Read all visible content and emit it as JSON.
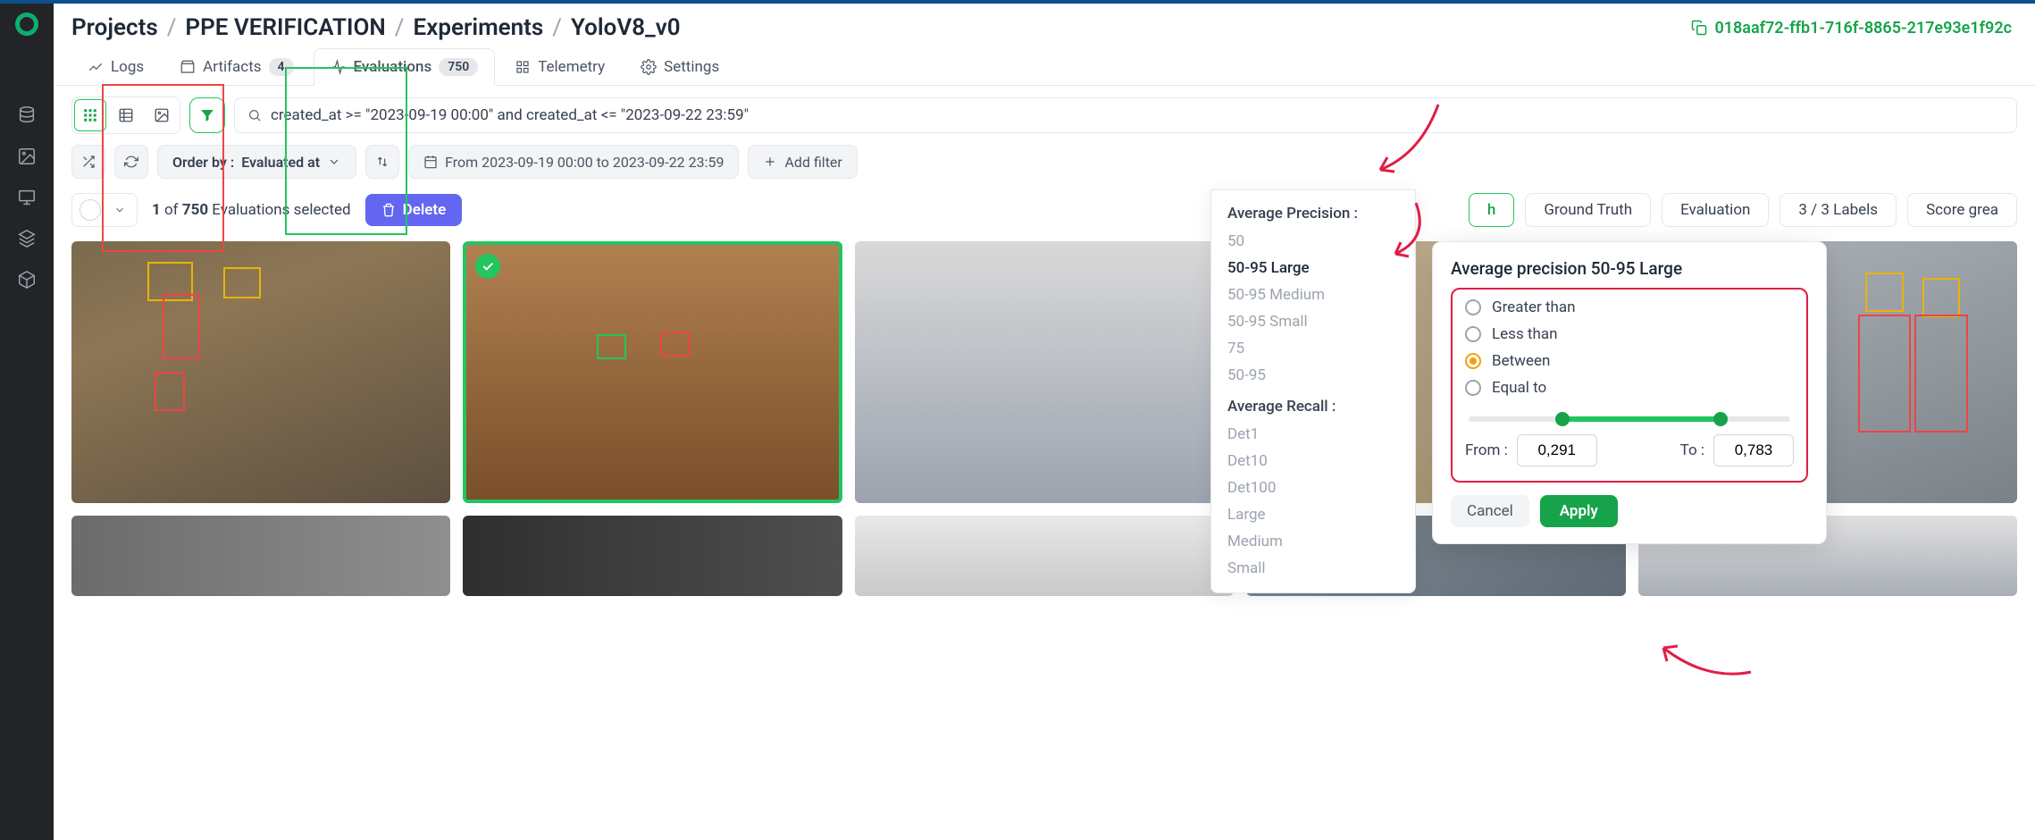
{
  "breadcrumb": {
    "p0": "Projects",
    "p1": "PPE VERIFICATION",
    "p2": "Experiments",
    "p3": "YoloV8_v0"
  },
  "experimentId": "018aaf72-ffb1-716f-8865-217e93e1f92c",
  "tabs": {
    "logs": "Logs",
    "artifacts": "Artifacts",
    "artifactsBadge": "4",
    "evaluations": "Evaluations",
    "evaluationsBadge": "750",
    "telemetry": "Telemetry",
    "settings": "Settings"
  },
  "search": {
    "query": "created_at >= \"2023-09-19 00:00\" and created_at <= \"2023-09-22 23:59\""
  },
  "toolbar": {
    "orderByLabel": "Order by :",
    "orderByValue": "Evaluated at",
    "dateRange": "From 2023-09-19 00:00 to 2023-09-22 23:59",
    "addFilter": "Add filter"
  },
  "selection": {
    "countPrefix": "1",
    "of": " of ",
    "total": "750",
    "suffix": " Evaluations selected",
    "delete": "Delete"
  },
  "viewChips": {
    "both": "h",
    "groundTruth": "Ground Truth",
    "evaluation": "Evaluation",
    "labels": "3 / 3 Labels",
    "score": "Score grea"
  },
  "filterMenu": {
    "h1": "Average Precision :",
    "items1": [
      "50",
      "50-95 Large",
      "50-95 Medium",
      "50-95 Small",
      "75",
      "50-95"
    ],
    "h2": "Average Recall :",
    "items2": [
      "Det1",
      "Det10",
      "Det100",
      "Large",
      "Medium",
      "Small"
    ]
  },
  "popover": {
    "title": "Average precision 50-95 Large",
    "opt1": "Greater than",
    "opt2": "Less than",
    "opt3": "Between",
    "opt4": "Equal to",
    "fromLabel": "From :",
    "fromValue": "0,291",
    "toLabel": "To :",
    "toValue": "0,783",
    "cancel": "Cancel",
    "apply": "Apply"
  }
}
